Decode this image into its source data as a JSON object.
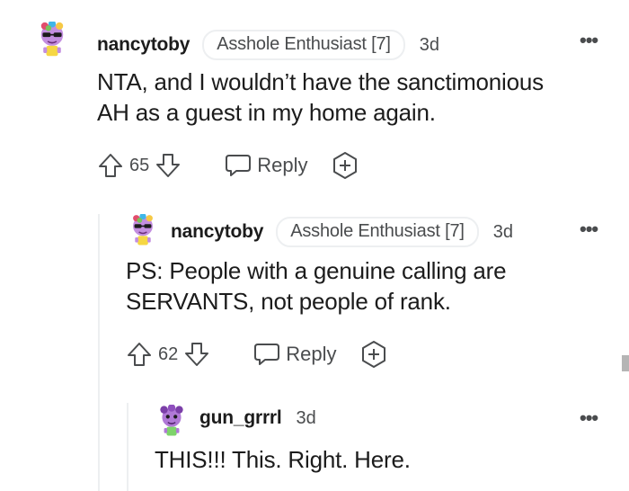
{
  "comments": [
    {
      "username": "nancytoby",
      "flair": "Asshole Enthusiast [7]",
      "time": "3d",
      "body_line1": "NTA, and I wouldn’t have the sanctimonious",
      "body_line2": "AH as a guest in my home again.",
      "votes": "65",
      "reply_label": "Reply"
    },
    {
      "username": "nancytoby",
      "flair": "Asshole Enthusiast [7]",
      "time": "3d",
      "body_line1": "PS: People with a genuine calling are",
      "body_line2": "SERVANTS, not people of rank.",
      "votes": "62",
      "reply_label": "Reply"
    },
    {
      "username": "gun_grrrl",
      "time": "3d",
      "body_line1": "THIS!!! This. Right. Here."
    }
  ],
  "icons": {
    "more": "more-options-icon",
    "upvote": "upvote-arrow-icon",
    "downvote": "downvote-arrow-icon",
    "reply": "speech-bubble-icon",
    "award": "award-plus-icon"
  },
  "colors": {
    "text": "#1c1c1c",
    "meta": "#4a4c4e",
    "border": "#edeff1"
  }
}
